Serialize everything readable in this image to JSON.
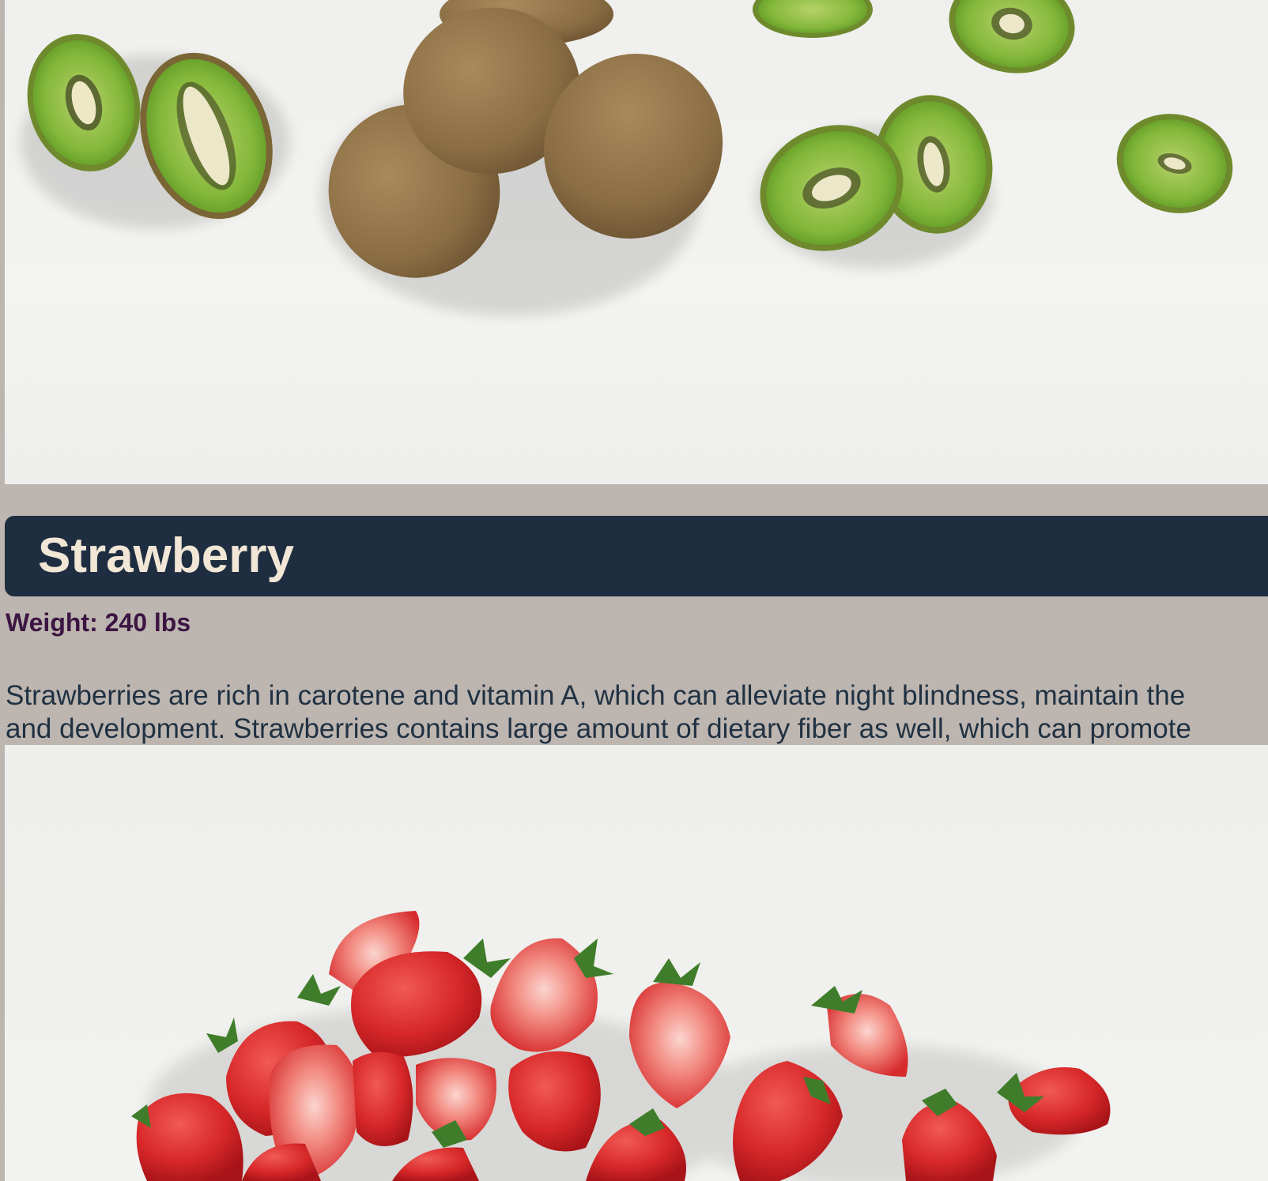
{
  "fruit": {
    "name": "Strawberry",
    "weight": "Weight: 240 lbs",
    "description_line1": "Strawberries are rich in carotene and vitamin A, which can alleviate night blindness, maintain the",
    "description_line2": "and development. Strawberries contains large amount of dietary fiber as well, which can promote"
  },
  "images": {
    "previous_fruit_photo": "kiwi-photo",
    "current_fruit_photo": "strawberry-photo"
  },
  "colors": {
    "page_background": "#bdb5b0",
    "header_background": "#1e2e40",
    "header_text": "#f2e6d6",
    "weight_text": "#3c1542",
    "description_text": "#1f3142"
  }
}
